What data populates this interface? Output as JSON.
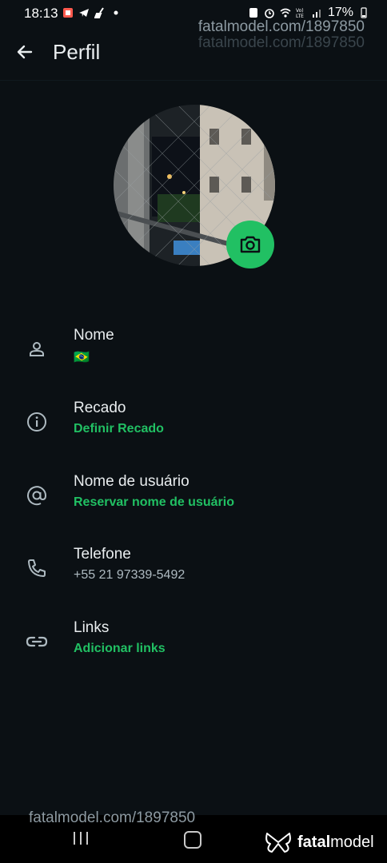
{
  "status_bar": {
    "time": "18:13",
    "battery": "17%",
    "icons_left": [
      "notification-app-icon",
      "telegram-icon",
      "broom-icon",
      "dot-icon"
    ],
    "icons_right": [
      "sim-icon",
      "alarm-icon",
      "wifi-icon",
      "volte-icon",
      "signal-icon",
      "battery-icon"
    ]
  },
  "watermark": {
    "top_line1": "fatalmodel.com/1897850",
    "top_line2": "fatalmodel.com/1897850",
    "bottom": "fatalmodel.com/1897850",
    "brand_a": "fatal",
    "brand_b": "model"
  },
  "app_bar": {
    "title": "Perfil"
  },
  "rows": [
    {
      "label": "Nome",
      "value": "🇧🇷",
      "icon": "person-icon",
      "value_style": "plain"
    },
    {
      "label": "Recado",
      "value": "Definir Recado",
      "icon": "info-icon",
      "value_style": "link"
    },
    {
      "label": "Nome de usuário",
      "value": "Reservar nome de usuário",
      "icon": "at-icon",
      "value_style": "link"
    },
    {
      "label": "Telefone",
      "value": "+55 21 97339-5492",
      "icon": "phone-icon",
      "value_style": "plain"
    },
    {
      "label": "Links",
      "value": "Adicionar links",
      "icon": "link-icon",
      "value_style": "link"
    }
  ],
  "colors": {
    "background": "#0b1014",
    "accent": "#21c063",
    "text_primary": "#e9edef",
    "text_secondary": "#aebac1"
  }
}
